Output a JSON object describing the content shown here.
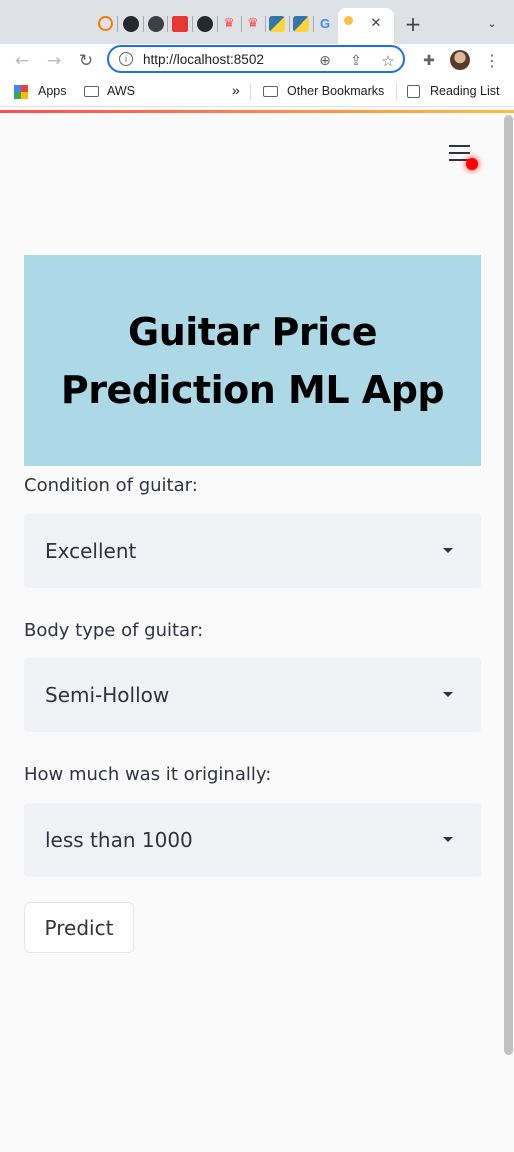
{
  "browser": {
    "url": "http://localhost:8502",
    "bookmarks": {
      "apps": "Apps",
      "aws": "AWS",
      "overflow": "»",
      "other": "Other Bookmarks",
      "reading_list": "Reading List"
    },
    "new_tab": "+",
    "close_tab": "✕"
  },
  "app": {
    "title_line1": "Guitar Price",
    "title_line2": "Prediction ML App",
    "banner_color": "#add8e6",
    "fields": [
      {
        "label": "Condition of guitar:",
        "value": "Excellent"
      },
      {
        "label": "Body type of guitar:",
        "value": "Semi-Hollow"
      },
      {
        "label": "How much was it originally:",
        "value": "less than 1000"
      }
    ],
    "predict_label": "Predict"
  }
}
